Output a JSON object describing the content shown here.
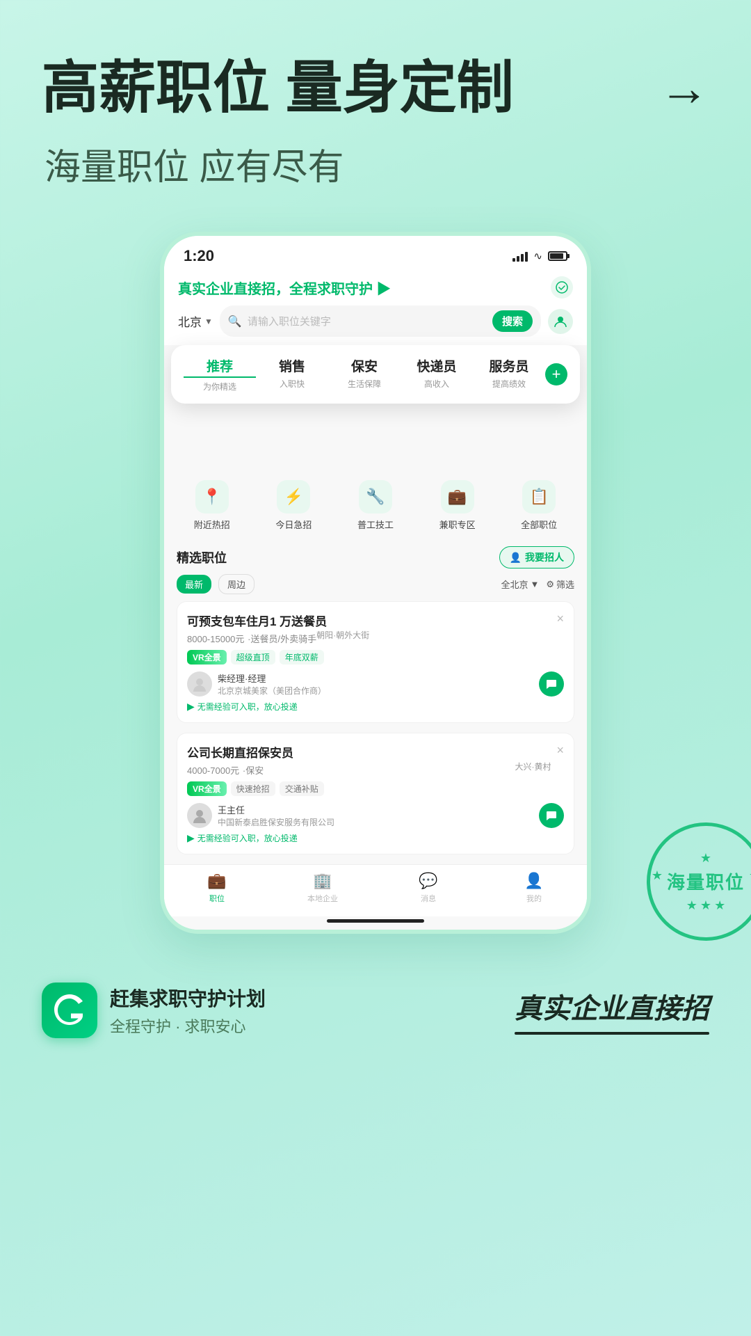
{
  "hero": {
    "title": "高薪职位 量身定制",
    "arrow": "→",
    "subtitle": "海量职位 应有尽有"
  },
  "phone": {
    "status": {
      "time": "1:20",
      "signal": "▌▌▌▌",
      "wifi": "WiFi",
      "battery": "Battery"
    },
    "header": {
      "title": "真实企业直接招，全程求职守护",
      "arrow": "▶",
      "verified_icon": "⊙",
      "location": "北京",
      "search_placeholder": "请输入职位关键字",
      "search_btn": "搜索"
    },
    "categories": {
      "tabs": [
        {
          "label": "推荐",
          "sub": "为你精选",
          "active": true
        },
        {
          "label": "销售",
          "sub": "入职快",
          "active": false
        },
        {
          "label": "保安",
          "sub": "生活保障",
          "active": false
        },
        {
          "label": "快递员",
          "sub": "高收入",
          "active": false
        },
        {
          "label": "服务员",
          "sub": "提高绩效",
          "active": false
        }
      ],
      "add_btn": "+"
    },
    "quick_nav": [
      {
        "icon": "📍",
        "label": "附近热招"
      },
      {
        "icon": "⚡",
        "label": "今日急招"
      },
      {
        "icon": "🔧",
        "label": "普工技工"
      },
      {
        "icon": "💼",
        "label": "兼职专区"
      },
      {
        "icon": "📋",
        "label": "全部职位"
      }
    ],
    "section": {
      "title": "精选职位",
      "hire_btn_icon": "👤",
      "hire_btn_label": "我要招人"
    },
    "filters": {
      "tab_new": "最新",
      "tab_nearby": "周边",
      "location": "全北京",
      "filter_label": "筛选"
    },
    "jobs": [
      {
        "title": "可预支包车住月1 万送餐员",
        "salary": "8000-15000元",
        "salary_suffix": "·送餐员/外卖骑手",
        "location": "朝阳·朝外大街",
        "tags": [
          "VR全景",
          "超级直顶",
          "年底双薪"
        ],
        "tag_types": [
          "vr",
          "normal",
          "normal"
        ],
        "recruiter_name": "柴经理·经理",
        "company": "北京京城美家（美团合作商）",
        "note": "无需经验可入职，放心投递",
        "close": "×"
      },
      {
        "title": "公司长期直招保安员",
        "salary": "4000-7000元",
        "salary_suffix": "·保安",
        "location": "大兴·黄村",
        "tags": [
          "VR全景",
          "快速抢招",
          "交通补贴"
        ],
        "tag_types": [
          "vr",
          "gray",
          "gray"
        ],
        "recruiter_name": "王主任",
        "company": "中国新泰启胜保安服务有限公司",
        "note": "无需经验可入职，放心投递",
        "close": "×"
      }
    ],
    "bottom_nav": [
      {
        "icon": "💼",
        "label": "职位",
        "active": true
      },
      {
        "icon": "🏢",
        "label": "本地企业",
        "active": false
      },
      {
        "icon": "💬",
        "label": "消息",
        "active": false
      },
      {
        "icon": "👤",
        "label": "我的",
        "active": false
      }
    ]
  },
  "stamp": {
    "text": "海量职位",
    "stars": [
      "★",
      "★",
      "★",
      "★",
      "★",
      "★"
    ]
  },
  "footer": {
    "logo_letter": "G",
    "brand_name": "赶集求职守护计划",
    "brand_sub": "全程守护 · 求职安心",
    "slogan": "真实企业直接招"
  }
}
